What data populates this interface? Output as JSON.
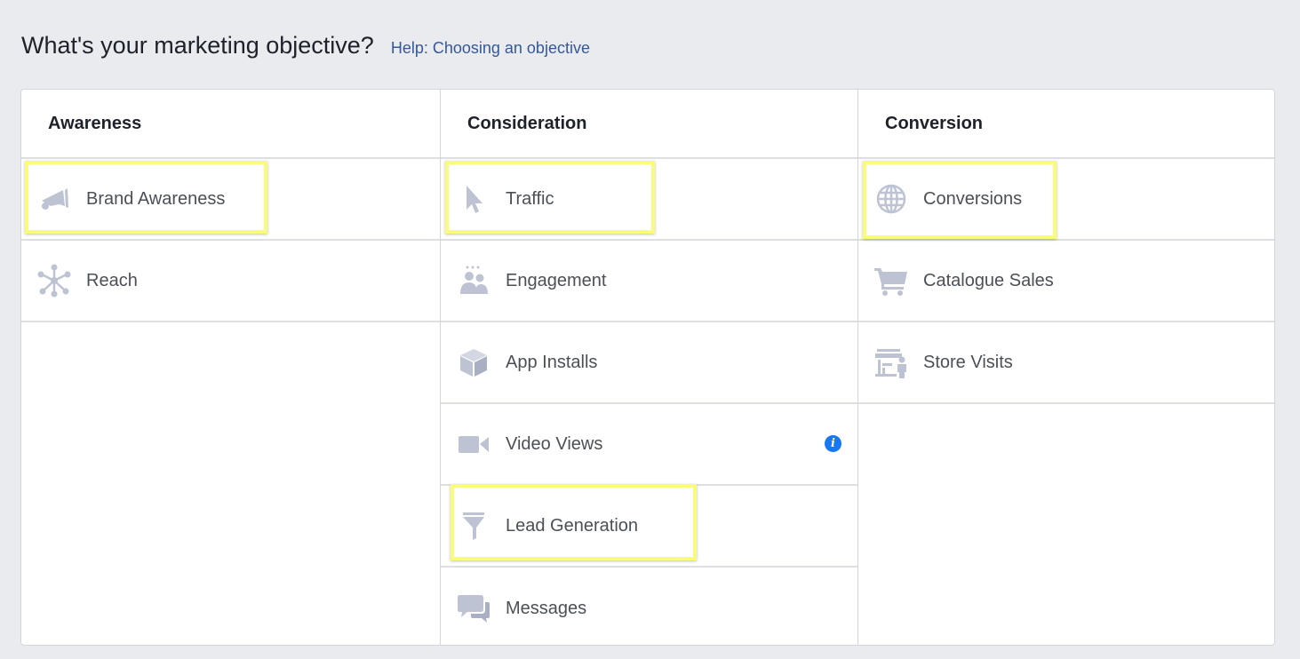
{
  "header": {
    "title": "What's your marketing objective?",
    "help_link": "Help: Choosing an objective"
  },
  "colors": {
    "highlight": "#fbfb7a",
    "icon": "#bec3d4",
    "link": "#365899"
  },
  "columns": [
    {
      "title": "Awareness",
      "items": [
        {
          "label": "Brand Awareness",
          "icon": "megaphone-icon",
          "highlighted": true
        },
        {
          "label": "Reach",
          "icon": "reach-network-icon",
          "highlighted": false
        }
      ]
    },
    {
      "title": "Consideration",
      "items": [
        {
          "label": "Traffic",
          "icon": "cursor-icon",
          "highlighted": true
        },
        {
          "label": "Engagement",
          "icon": "people-icon",
          "highlighted": false
        },
        {
          "label": "App Installs",
          "icon": "box-icon",
          "highlighted": false
        },
        {
          "label": "Video Views",
          "icon": "video-camera-icon",
          "highlighted": false,
          "info_icon": "info-icon"
        },
        {
          "label": "Lead Generation",
          "icon": "funnel-icon",
          "highlighted": true
        },
        {
          "label": "Messages",
          "icon": "chat-bubbles-icon",
          "highlighted": false
        }
      ]
    },
    {
      "title": "Conversion",
      "items": [
        {
          "label": "Conversions",
          "icon": "globe-icon",
          "highlighted": true
        },
        {
          "label": "Catalogue Sales",
          "icon": "shopping-cart-icon",
          "highlighted": false
        },
        {
          "label": "Store Visits",
          "icon": "store-icon",
          "highlighted": false
        }
      ]
    }
  ]
}
